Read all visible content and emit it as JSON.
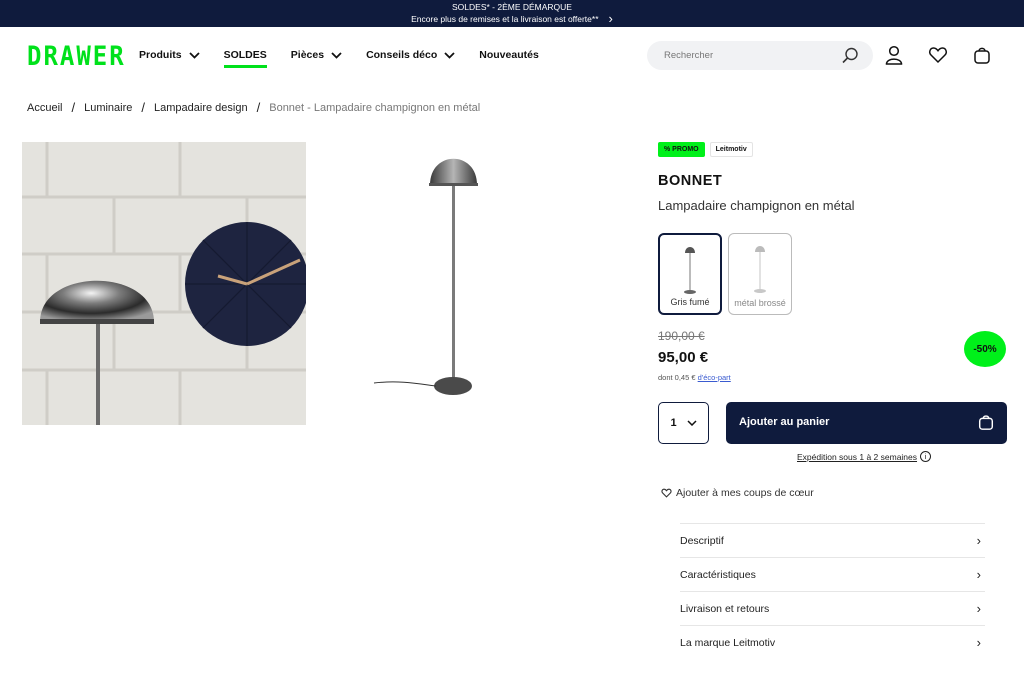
{
  "promo_bar": {
    "line1": "SOLDES* - 2ÈME DÉMARQUE",
    "line2": "Encore plus de remises et la livraison est offerte**"
  },
  "header": {
    "logo": "DRAWER",
    "nav": [
      {
        "label": "Produits",
        "has_caret": true
      },
      {
        "label": "SOLDES",
        "has_caret": false,
        "active": true
      },
      {
        "label": "Pièces",
        "has_caret": true
      },
      {
        "label": "Conseils déco",
        "has_caret": true
      },
      {
        "label": "Nouveautés",
        "has_caret": false
      }
    ],
    "search_placeholder": "Rechercher",
    "icons": [
      "search-icon",
      "user-icon",
      "heart-icon",
      "bag-icon"
    ]
  },
  "breadcrumb": {
    "items": [
      "Accueil",
      "Luminaire",
      "Lampadaire design"
    ],
    "current": "Bonnet - Lampadaire champignon en métal"
  },
  "product": {
    "tag_promo": "PROMO",
    "tag_brand": "Leitmotiv",
    "title": "BONNET",
    "subtitle": "Lampadaire champignon en métal",
    "variants": [
      {
        "label": "Gris fumé",
        "selected": true
      },
      {
        "label": "métal brossé",
        "selected": false
      }
    ],
    "old_price": "190,00 €",
    "price": "95,00 €",
    "eco_prefix": "dont 0,45 €",
    "eco_link": "d'éco-part",
    "discount": "-50%",
    "quantity": "1",
    "add_to_cart": "Ajouter au panier",
    "shipping": "Expédition sous 1 à 2 semaines",
    "wishlist": "Ajouter à mes coups de cœur",
    "accordion": [
      "Descriptif",
      "Caractéristiques",
      "Livraison et retours",
      "La marque Leitmotiv"
    ]
  },
  "colors": {
    "navy": "#0f1b3d",
    "accent_green": "#00e11b"
  }
}
